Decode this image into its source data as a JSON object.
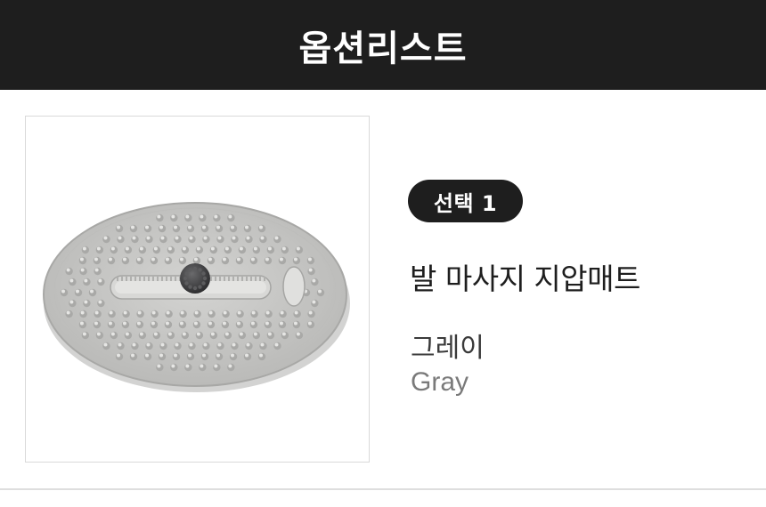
{
  "header": {
    "title": "옵션리스트"
  },
  "option": {
    "badge_label": "선택 1",
    "product_name": "발 마사지 지압매트",
    "color_korean": "그레이",
    "color_english": "Gray"
  },
  "image": {
    "icon": "massage-mat-image",
    "mat_color": "#c9c9c7",
    "ball_color": "#4a4a4c"
  }
}
